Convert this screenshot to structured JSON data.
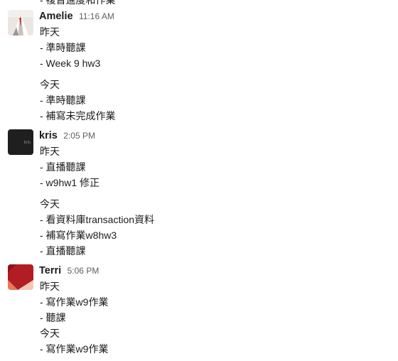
{
  "top_cut_text": "- 複習進度和作業",
  "messages": [
    {
      "author": "Amelie",
      "time": "11:16 AM",
      "lines": [
        "昨天",
        "- 準時聽課",
        "- Week 9 hw3",
        "今天",
        "- 準時聽課",
        "- 補寫未完成作業"
      ]
    },
    {
      "author": "kris",
      "time": "2:05 PM",
      "avatar_text": "kris",
      "lines": [
        "昨天",
        "- 直播聽課",
        "- w9hw1 修正",
        "今天",
        "- 看資料庫transaction資料",
        "- 補寫作業w8hw3",
        "- 直播聽課"
      ]
    },
    {
      "author": "Terri",
      "time": "5:06 PM",
      "lines": [
        "昨天",
        "- 寫作業w9作業",
        "- 聽課",
        "今天",
        "- 寫作業w9作業"
      ]
    }
  ],
  "colors": {
    "text": "#1d1c1d",
    "timestamp": "#616061",
    "kris_avatar": "#1f1f1f",
    "terri_avatar_red": "#b21d24",
    "terri_avatar_orange": "#e7785a"
  }
}
